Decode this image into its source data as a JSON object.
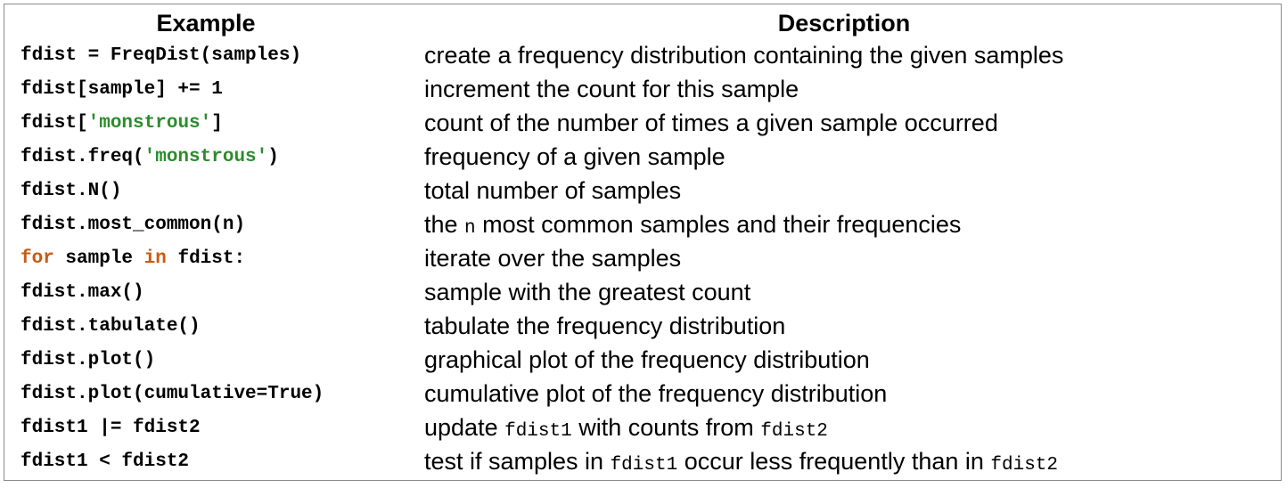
{
  "table": {
    "headers": {
      "example": "Example",
      "description": "Description"
    },
    "rows": [
      {
        "ex": [
          {
            "t": "fdist = FreqDist(samples)"
          }
        ],
        "desc": [
          {
            "t": "create a frequency distribution containing the given samples"
          }
        ]
      },
      {
        "ex": [
          {
            "t": "fdist[sample] += 1"
          }
        ],
        "desc": [
          {
            "t": "increment the count for this sample"
          }
        ]
      },
      {
        "ex": [
          {
            "t": "fdist["
          },
          {
            "t": "'monstrous'",
            "k": "str"
          },
          {
            "t": "]"
          }
        ],
        "desc": [
          {
            "t": "count of the number of times a given sample occurred"
          }
        ]
      },
      {
        "ex": [
          {
            "t": "fdist.freq("
          },
          {
            "t": "'monstrous'",
            "k": "str"
          },
          {
            "t": ")"
          }
        ],
        "desc": [
          {
            "t": "frequency of a given sample"
          }
        ]
      },
      {
        "ex": [
          {
            "t": "fdist.N()"
          }
        ],
        "desc": [
          {
            "t": "total number of samples"
          }
        ]
      },
      {
        "ex": [
          {
            "t": "fdist.most_common(n)"
          }
        ],
        "desc": [
          {
            "t": "the "
          },
          {
            "t": "n",
            "k": "code"
          },
          {
            "t": " most common samples and their frequencies"
          }
        ]
      },
      {
        "ex": [
          {
            "t": "for",
            "k": "kw"
          },
          {
            "t": " sample "
          },
          {
            "t": "in",
            "k": "kw"
          },
          {
            "t": " fdist:"
          }
        ],
        "desc": [
          {
            "t": "iterate over the samples"
          }
        ]
      },
      {
        "ex": [
          {
            "t": "fdist.max()"
          }
        ],
        "desc": [
          {
            "t": "sample with the greatest count"
          }
        ]
      },
      {
        "ex": [
          {
            "t": "fdist.tabulate()"
          }
        ],
        "desc": [
          {
            "t": "tabulate the frequency distribution"
          }
        ]
      },
      {
        "ex": [
          {
            "t": "fdist.plot()"
          }
        ],
        "desc": [
          {
            "t": "graphical plot of the frequency distribution"
          }
        ]
      },
      {
        "ex": [
          {
            "t": "fdist.plot(cumulative=True)"
          }
        ],
        "desc": [
          {
            "t": "cumulative plot of the frequency distribution"
          }
        ]
      },
      {
        "ex": [
          {
            "t": "fdist1 |= fdist2"
          }
        ],
        "desc": [
          {
            "t": "update "
          },
          {
            "t": "fdist1",
            "k": "code"
          },
          {
            "t": " with counts from "
          },
          {
            "t": "fdist2",
            "k": "code"
          }
        ]
      },
      {
        "ex": [
          {
            "t": "fdist1 < fdist2"
          }
        ],
        "desc": [
          {
            "t": "test if samples in "
          },
          {
            "t": "fdist1",
            "k": "code"
          },
          {
            "t": " occur less frequently than in "
          },
          {
            "t": "fdist2",
            "k": "code"
          }
        ]
      }
    ]
  },
  "colors": {
    "string_literal": "#2e8b2e",
    "keyword": "#c85a14",
    "border": "#8a8a8a"
  }
}
